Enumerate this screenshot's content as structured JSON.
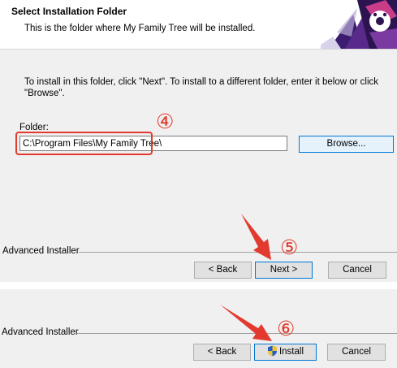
{
  "header": {
    "title": "Select Installation Folder",
    "subtitle": "This is the folder where My Family Tree will be installed.",
    "logo_icon": "advanced-installer-logo"
  },
  "main": {
    "instruction": "To install in this folder, click \"Next\". To install to a different folder, enter it below or click \"Browse\".",
    "folder_label": "Folder:",
    "folder_value": "C:\\Program Files\\My Family Tree\\",
    "browse_label": "Browse..."
  },
  "step1": {
    "installer_label": "Advanced Installer",
    "back_label": "< Back",
    "next_label": "Next >",
    "cancel_label": "Cancel"
  },
  "step2": {
    "installer_label": "Advanced Installer",
    "back_label": "< Back",
    "install_label": "Install",
    "cancel_label": "Cancel",
    "install_icon": "uac-shield-icon"
  },
  "annotations": {
    "step4": "④",
    "step5": "⑤",
    "step6": "⑥",
    "color": "#e23a2e"
  }
}
